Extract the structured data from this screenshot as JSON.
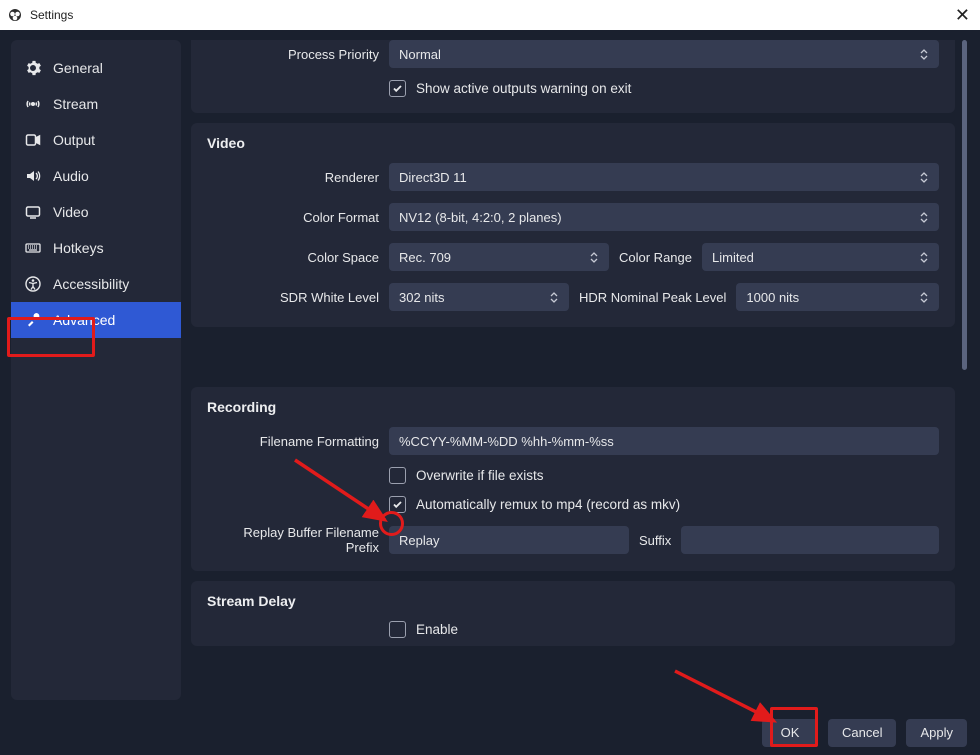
{
  "window": {
    "title": "Settings",
    "close": "✕"
  },
  "sidebar": {
    "items": [
      {
        "label": "General"
      },
      {
        "label": "Stream"
      },
      {
        "label": "Output"
      },
      {
        "label": "Audio"
      },
      {
        "label": "Video"
      },
      {
        "label": "Hotkeys"
      },
      {
        "label": "Accessibility"
      },
      {
        "label": "Advanced"
      }
    ]
  },
  "top": {
    "process_priority_label": "Process Priority",
    "process_priority_value": "Normal",
    "show_outputs_warning": "Show active outputs warning on exit"
  },
  "video": {
    "title": "Video",
    "renderer_label": "Renderer",
    "renderer_value": "Direct3D 11",
    "color_format_label": "Color Format",
    "color_format_value": "NV12 (8-bit, 4:2:0, 2 planes)",
    "color_space_label": "Color Space",
    "color_space_value": "Rec. 709",
    "color_range_label": "Color Range",
    "color_range_value": "Limited",
    "sdr_label": "SDR White Level",
    "sdr_value": "302 nits",
    "hdr_label": "HDR Nominal Peak Level",
    "hdr_value": "1000 nits"
  },
  "recording": {
    "title": "Recording",
    "filename_label": "Filename Formatting",
    "filename_value": "%CCYY-%MM-%DD %hh-%mm-%ss",
    "overwrite": "Overwrite if file exists",
    "remux": "Automatically remux to mp4 (record as mkv)",
    "replay_prefix_label": "Replay Buffer Filename Prefix",
    "replay_prefix_value": "Replay",
    "suffix_label": "Suffix"
  },
  "stream_delay": {
    "title": "Stream Delay",
    "enable": "Enable"
  },
  "footer": {
    "ok": "OK",
    "cancel": "Cancel",
    "apply": "Apply"
  }
}
